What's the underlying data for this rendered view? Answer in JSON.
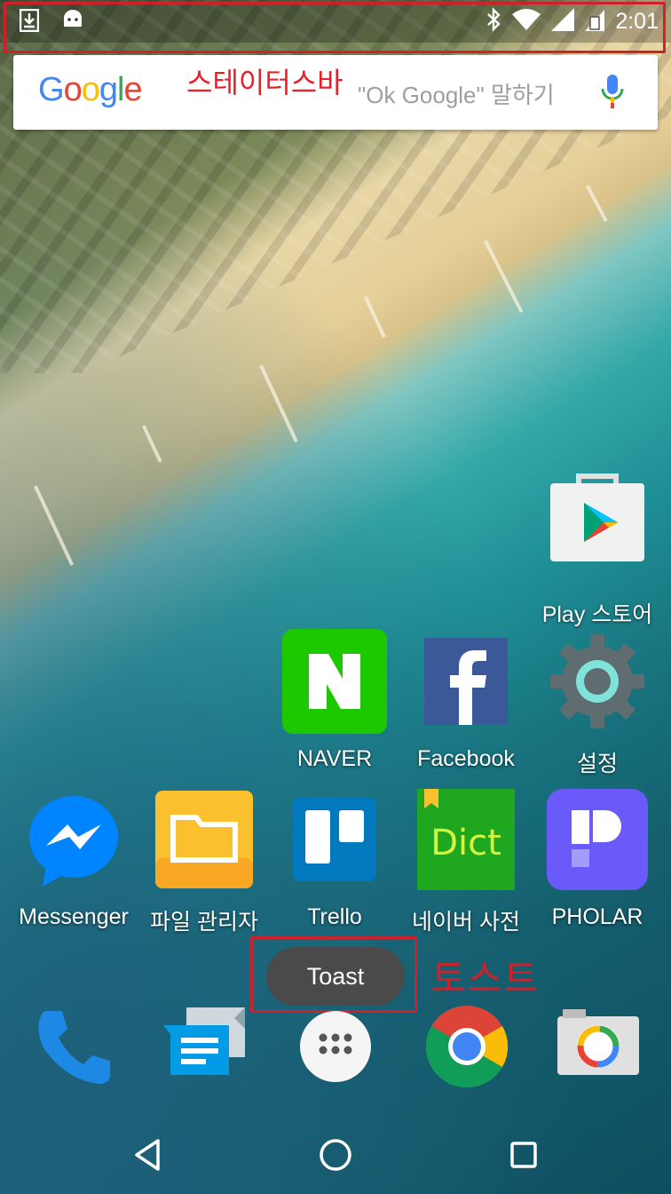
{
  "status_bar": {
    "time": "2:01",
    "left_icons": [
      "download-icon",
      "android-icon"
    ],
    "right_icons": [
      "bluetooth-icon",
      "wifi-icon",
      "signal-icon",
      "battery-icon"
    ]
  },
  "annotations": {
    "status_bar_label": "스테이터스바",
    "toast_label": "토스트",
    "highlight_color": "#d0212b"
  },
  "search": {
    "logo": "Google",
    "hint": "\"Ok Google\" 말하기",
    "mic_icon": "mic-icon"
  },
  "apps": [
    {
      "label": "Play 스토어",
      "icon": "play-store-icon"
    },
    {
      "label": "NAVER",
      "icon": "naver-icon"
    },
    {
      "label": "Facebook",
      "icon": "facebook-icon"
    },
    {
      "label": "설정",
      "icon": "settings-icon"
    },
    {
      "label": "Messenger",
      "icon": "messenger-icon"
    },
    {
      "label": "파일 관리자",
      "icon": "file-manager-icon"
    },
    {
      "label": "Trello",
      "icon": "trello-icon"
    },
    {
      "label": "네이버 사전",
      "icon": "naver-dict-icon"
    },
    {
      "label": "PHOLAR",
      "icon": "pholar-icon"
    }
  ],
  "dict_icon_text": "Dict",
  "toast": {
    "text": "Toast"
  },
  "dock": [
    "phone-icon",
    "messages-icon",
    "app-drawer-icon",
    "chrome-icon",
    "camera-icon"
  ],
  "nav": [
    "back-icon",
    "home-icon",
    "recents-icon"
  ]
}
